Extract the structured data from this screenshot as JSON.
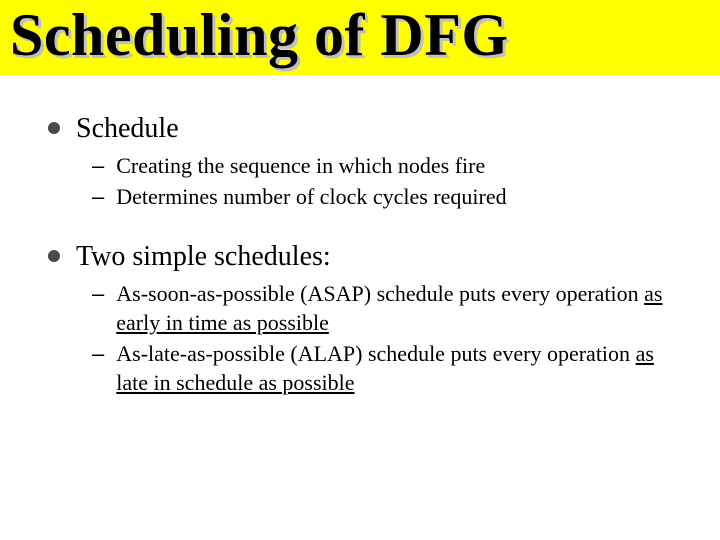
{
  "title": "Scheduling of DFG",
  "sections": [
    {
      "heading": "Schedule",
      "items": [
        {
          "plain": "Creating the sequence in which nodes fire"
        },
        {
          "plain": "Determines number of clock cycles required"
        }
      ]
    },
    {
      "heading": "Two simple schedules:",
      "items": [
        {
          "pre": "As-soon-as-possible (ASAP) schedule puts every operation ",
          "underlined": "as early in time as possible",
          "post": ""
        },
        {
          "pre": "As-late-as-possible (ALAP) schedule puts every operation ",
          "underlined": "as late in schedule as possible",
          "post": ""
        }
      ]
    }
  ]
}
